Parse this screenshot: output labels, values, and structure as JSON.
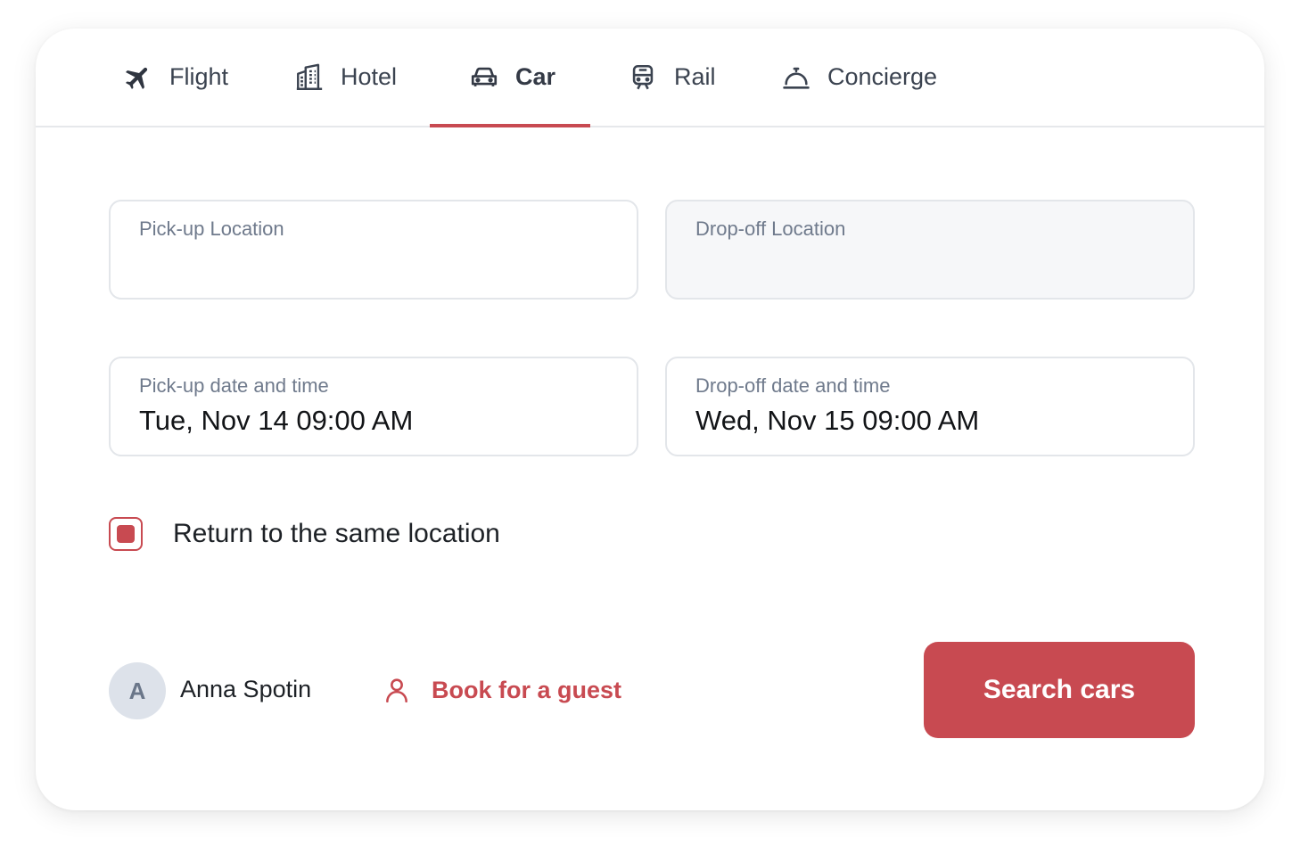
{
  "tabs": [
    {
      "label": "Flight",
      "icon": "airplane-icon"
    },
    {
      "label": "Hotel",
      "icon": "building-icon"
    },
    {
      "label": "Car",
      "icon": "car-icon",
      "active": true
    },
    {
      "label": "Rail",
      "icon": "train-icon"
    },
    {
      "label": "Concierge",
      "icon": "service-bell-icon"
    }
  ],
  "form": {
    "pickup_location": {
      "label": "Pick-up Location",
      "value": ""
    },
    "dropoff_location": {
      "label": "Drop-off Location",
      "value": ""
    },
    "pickup_datetime": {
      "label": "Pick-up date and time",
      "value": "Tue, Nov 14 09:00 AM"
    },
    "dropoff_datetime": {
      "label": "Drop-off date and time",
      "value": "Wed, Nov 15 09:00 AM"
    },
    "same_location": {
      "label": "Return to the same location",
      "checked": true
    }
  },
  "footer": {
    "avatar_initial": "A",
    "user_name": "Anna Spotin",
    "guest_label": "Book for a guest",
    "search_label": "Search cars"
  },
  "colors": {
    "accent": "#c84a51",
    "border": "#e3e6ea",
    "muted_text": "#6f7a8c",
    "disabled_field": "#f6f7f9"
  }
}
